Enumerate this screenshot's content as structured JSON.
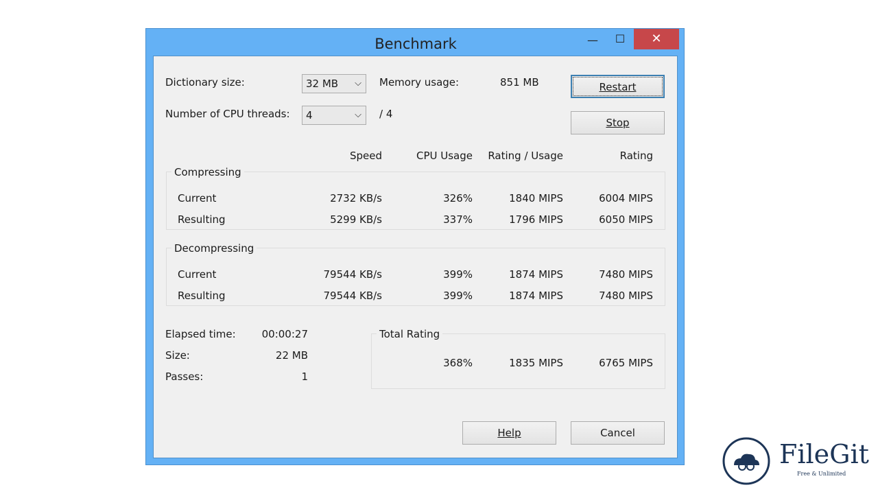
{
  "window": {
    "title": "Benchmark",
    "minimize": "—",
    "maximize": "☐",
    "close": "✕"
  },
  "settings": {
    "dictionary_label": "Dictionary size:",
    "dictionary_value": "32 MB",
    "threads_label": "Number of CPU threads:",
    "threads_value": "4",
    "threads_max": "/ 4",
    "memory_label": "Memory usage:",
    "memory_value": "851 MB"
  },
  "buttons": {
    "restart": "Restart",
    "stop": "Stop",
    "help": "Help",
    "cancel": "Cancel"
  },
  "columns": [
    "Speed",
    "CPU Usage",
    "Rating / Usage",
    "Rating"
  ],
  "compressing": {
    "title": "Compressing",
    "rows": [
      {
        "label": "Current",
        "values": [
          "2732 KB/s",
          "326%",
          "1840 MIPS",
          "6004 MIPS"
        ]
      },
      {
        "label": "Resulting",
        "values": [
          "5299 KB/s",
          "337%",
          "1796 MIPS",
          "6050 MIPS"
        ]
      }
    ]
  },
  "decompressing": {
    "title": "Decompressing",
    "rows": [
      {
        "label": "Current",
        "values": [
          "79544 KB/s",
          "399%",
          "1874 MIPS",
          "7480 MIPS"
        ]
      },
      {
        "label": "Resulting",
        "values": [
          "79544 KB/s",
          "399%",
          "1874 MIPS",
          "7480 MIPS"
        ]
      }
    ]
  },
  "stats": [
    {
      "label": "Elapsed time:",
      "value": "00:00:27"
    },
    {
      "label": "Size:",
      "value": "22 MB"
    },
    {
      "label": "Passes:",
      "value": "1"
    }
  ],
  "total": {
    "title": "Total Rating",
    "values": [
      "368%",
      "1835 MIPS",
      "6765 MIPS"
    ]
  },
  "watermark": {
    "name": "FileGit",
    "tagline": "Free & Unlimited"
  }
}
